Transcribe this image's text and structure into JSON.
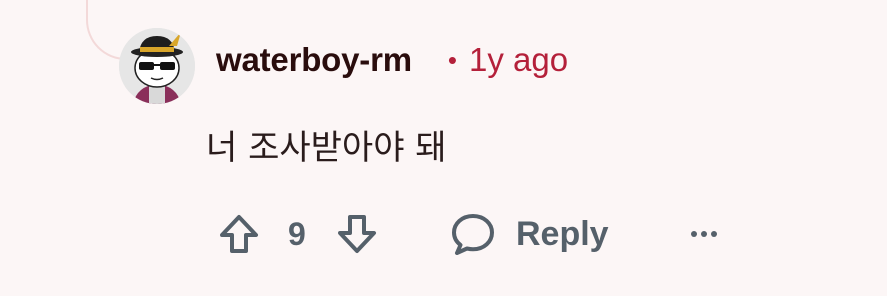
{
  "comment": {
    "author": "waterboy-rm",
    "separator": "•",
    "timestamp": "1y ago",
    "body": "너 조사받아야 돼",
    "score": "9",
    "reply_label": "Reply",
    "more_label": "..."
  },
  "colors": {
    "background": "#fcf6f6",
    "username": "#2a0d0d",
    "timestamp": "#b4203a",
    "action": "#55606a"
  }
}
